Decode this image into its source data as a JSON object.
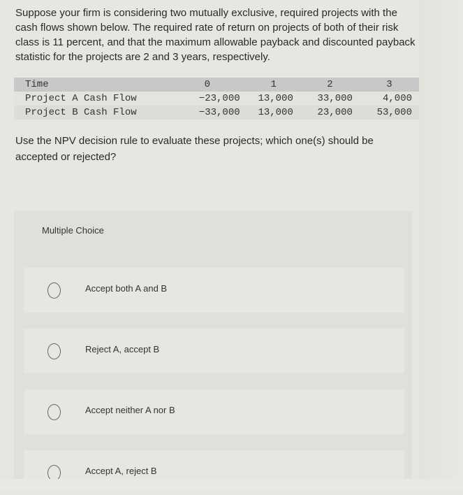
{
  "question": {
    "text": "Suppose your firm is considering two mutually exclusive, required projects with the cash flows shown below. The required rate of return on projects of both of their risk class is 11 percent, and that the maximum allowable payback and discounted payback statistic for the projects are 2 and 3 years, respectively."
  },
  "cash_flow_table": {
    "header": {
      "label": "Time",
      "periods": [
        "0",
        "1",
        "2",
        "3"
      ]
    },
    "rows": [
      {
        "label": "Project A Cash Flow",
        "values": [
          "−23,000",
          "13,000",
          "33,000",
          "4,000"
        ]
      },
      {
        "label": "Project B Cash Flow",
        "values": [
          "−33,000",
          "13,000",
          "23,000",
          "53,000"
        ]
      }
    ]
  },
  "prompt": {
    "text": "Use the NPV decision rule to evaluate these projects; which one(s) should be accepted or rejected?"
  },
  "multiple_choice": {
    "title": "Multiple Choice",
    "options": [
      {
        "label": "Accept both A and B",
        "selected": false
      },
      {
        "label": "Reject A, accept B",
        "selected": false
      },
      {
        "label": "Accept neither A nor B",
        "selected": false
      },
      {
        "label": "Accept A, reject B",
        "selected": false
      }
    ]
  }
}
